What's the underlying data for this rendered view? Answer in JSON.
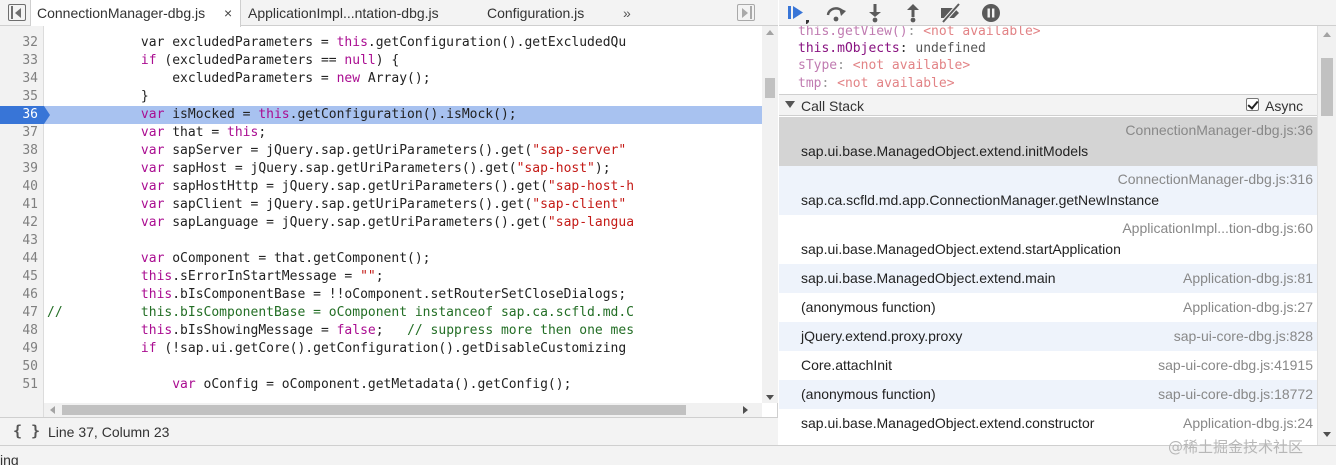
{
  "editor": {
    "tabs": [
      {
        "label": "ConnectionManager-dbg.js",
        "active": true
      },
      {
        "label": "ApplicationImpl...ntation-dbg.js"
      },
      {
        "label": "Configuration.js"
      }
    ],
    "close_glyph": "×",
    "more_glyph": "»",
    "status": {
      "format_glyph": "{ }",
      "cursor": "Line 37, Column 23"
    },
    "breakpoint_line": 36,
    "lines": [
      {
        "n": "32",
        "parts": [
          [
            "",
            "            var excludedParameters = "
          ],
          [
            "kw",
            "this"
          ],
          [
            "",
            ".getConfiguration().getExcludedQu"
          ]
        ]
      },
      {
        "n": "33",
        "parts": [
          [
            "",
            "            "
          ],
          [
            "kw",
            "if"
          ],
          [
            "",
            " (excludedParameters == "
          ],
          [
            "kw",
            "null"
          ],
          [
            "",
            ") {"
          ]
        ]
      },
      {
        "n": "34",
        "parts": [
          [
            "",
            "                excludedParameters = "
          ],
          [
            "kw",
            "new"
          ],
          [
            "",
            " Array();"
          ]
        ]
      },
      {
        "n": "35",
        "parts": [
          [
            "",
            "            }"
          ]
        ]
      },
      {
        "n": "36",
        "parts": [
          [
            "",
            "            "
          ],
          [
            "kw",
            "var"
          ],
          [
            "",
            " isMocked = "
          ],
          [
            "kw",
            "this"
          ],
          [
            "",
            ".getConfiguration().isMock();"
          ]
        ]
      },
      {
        "n": "37",
        "parts": [
          [
            "",
            "            "
          ],
          [
            "kw",
            "var"
          ],
          [
            "",
            " that = "
          ],
          [
            "kw",
            "this"
          ],
          [
            "",
            ";"
          ]
        ]
      },
      {
        "n": "38",
        "parts": [
          [
            "",
            "            "
          ],
          [
            "kw",
            "var"
          ],
          [
            "",
            " sapServer = jQuery.sap.getUriParameters().get("
          ],
          [
            "str",
            "\"sap-server\""
          ]
        ]
      },
      {
        "n": "39",
        "parts": [
          [
            "",
            "            "
          ],
          [
            "kw",
            "var"
          ],
          [
            "",
            " sapHost = jQuery.sap.getUriParameters().get("
          ],
          [
            "str",
            "\"sap-host\""
          ],
          [
            "",
            ");"
          ]
        ]
      },
      {
        "n": "40",
        "parts": [
          [
            "",
            "            "
          ],
          [
            "kw",
            "var"
          ],
          [
            "",
            " sapHostHttp = jQuery.sap.getUriParameters().get("
          ],
          [
            "str",
            "\"sap-host-h"
          ]
        ]
      },
      {
        "n": "41",
        "parts": [
          [
            "",
            "            "
          ],
          [
            "kw",
            "var"
          ],
          [
            "",
            " sapClient = jQuery.sap.getUriParameters().get("
          ],
          [
            "str",
            "\"sap-client\""
          ]
        ]
      },
      {
        "n": "42",
        "parts": [
          [
            "",
            "            "
          ],
          [
            "kw",
            "var"
          ],
          [
            "",
            " sapLanguage = jQuery.sap.getUriParameters().get("
          ],
          [
            "str",
            "\"sap-langua"
          ]
        ]
      },
      {
        "n": "43",
        "parts": [
          [
            "",
            ""
          ]
        ]
      },
      {
        "n": "44",
        "parts": [
          [
            "",
            "            "
          ],
          [
            "kw",
            "var"
          ],
          [
            "",
            " oComponent = that.getComponent();"
          ]
        ]
      },
      {
        "n": "45",
        "parts": [
          [
            "",
            "            "
          ],
          [
            "kw",
            "this"
          ],
          [
            "",
            ".sErrorInStartMessage = "
          ],
          [
            "str",
            "\"\""
          ],
          [
            "",
            ";"
          ]
        ]
      },
      {
        "n": "46",
        "parts": [
          [
            "",
            "            "
          ],
          [
            "kw",
            "this"
          ],
          [
            "",
            ".bIsComponentBase = !!oComponent.setRouterSetCloseDialogs;"
          ]
        ]
      },
      {
        "n": "47",
        "parts": [
          [
            "cm",
            "//          this.bIsComponentBase = oComponent instanceof sap.ca.scfld.md.C"
          ]
        ]
      },
      {
        "n": "48",
        "parts": [
          [
            "",
            "            "
          ],
          [
            "kw",
            "this"
          ],
          [
            "",
            ".bIsShowingMessage = "
          ],
          [
            "kw",
            "false"
          ],
          [
            "",
            ";   "
          ],
          [
            "cm",
            "// suppress more then one mes"
          ]
        ]
      },
      {
        "n": "49",
        "parts": [
          [
            "",
            "            "
          ],
          [
            "kw",
            "if"
          ],
          [
            "",
            " (!sap.ui.getCore().getConfiguration().getDisableCustomizing"
          ]
        ]
      },
      {
        "n": "50",
        "parts": [
          [
            "",
            ""
          ]
        ]
      },
      {
        "n": "51",
        "parts": [
          [
            "",
            "                "
          ],
          [
            "kw",
            "var"
          ],
          [
            "",
            " oConfig = oComponent.getMetadata().getConfig();"
          ]
        ]
      }
    ]
  },
  "scope": {
    "vars": [
      {
        "name": "this.getView()",
        "sep": ": ",
        "value": "<not available>",
        "kind": "na",
        "dim": true
      },
      {
        "name": "this.mObjects",
        "sep": ": ",
        "value": "undefined",
        "kind": "undef"
      },
      {
        "name": "sType",
        "sep": ": ",
        "value": "<not available>",
        "kind": "na",
        "dim": true
      },
      {
        "name": "tmp",
        "sep": ": ",
        "value": "<not available>",
        "kind": "na",
        "dim": true
      }
    ]
  },
  "callstack": {
    "title": "Call Stack",
    "async_label": "Async",
    "async_checked": true,
    "frames": [
      {
        "fn": "sap.ui.base.ManagedObject.extend.initModels",
        "loc": "ConnectionManager-dbg.js:36",
        "tall": true,
        "selected": true
      },
      {
        "fn": "sap.ca.scfld.md.app.ConnectionManager.getNewInstance",
        "loc": "ConnectionManager-dbg.js:316",
        "tall": true
      },
      {
        "fn": "sap.ui.base.ManagedObject.extend.startApplication",
        "loc": "ApplicationImpl...tion-dbg.js:60",
        "tall": true
      },
      {
        "fn": "sap.ui.base.ManagedObject.extend.main",
        "loc": "Application-dbg.js:81"
      },
      {
        "fn": "(anonymous function)",
        "loc": "Application-dbg.js:27"
      },
      {
        "fn": "jQuery.extend.proxy.proxy",
        "loc": "sap-ui-core-dbg.js:828"
      },
      {
        "fn": "Core.attachInit",
        "loc": "sap-ui-core-dbg.js:41915"
      },
      {
        "fn": "(anonymous function)",
        "loc": "sap-ui-core-dbg.js:18772"
      },
      {
        "fn": "sap.ui.base.ManagedObject.extend.constructor",
        "loc": "Application-dbg.js:24"
      }
    ]
  },
  "toolbar": {
    "icons": [
      "resume-icon",
      "step-over-icon",
      "step-into-icon",
      "step-out-icon",
      "deactivate-breakpoints-icon",
      "pause-on-exceptions-icon"
    ]
  },
  "colors": {
    "accent": "#3875d7",
    "highlight": "#a8c2f0",
    "keyword": "#aa0d91",
    "string": "#c41a16"
  },
  "bottom": {
    "text": "ing"
  },
  "watermark": "@稀土掘金技术社区"
}
